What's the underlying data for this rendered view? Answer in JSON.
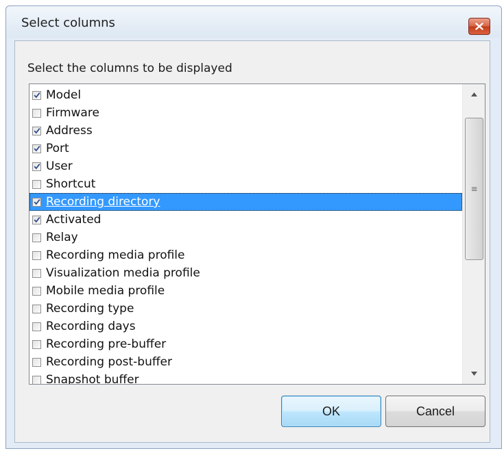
{
  "window": {
    "title": "Select columns",
    "close_icon": "close-icon"
  },
  "dialog": {
    "prompt": "Select the columns to be displayed",
    "items": [
      {
        "label": "Model",
        "checked": true,
        "selected": false
      },
      {
        "label": "Firmware",
        "checked": false,
        "selected": false
      },
      {
        "label": "Address",
        "checked": true,
        "selected": false
      },
      {
        "label": "Port",
        "checked": true,
        "selected": false
      },
      {
        "label": "User",
        "checked": true,
        "selected": false
      },
      {
        "label": "Shortcut",
        "checked": false,
        "selected": false
      },
      {
        "label": "Recording directory",
        "checked": true,
        "selected": true
      },
      {
        "label": "Activated",
        "checked": true,
        "selected": false
      },
      {
        "label": "Relay",
        "checked": false,
        "selected": false
      },
      {
        "label": "Recording media profile",
        "checked": false,
        "selected": false
      },
      {
        "label": "Visualization media profile",
        "checked": false,
        "selected": false
      },
      {
        "label": "Mobile media profile",
        "checked": false,
        "selected": false
      },
      {
        "label": "Recording type",
        "checked": false,
        "selected": false
      },
      {
        "label": "Recording days",
        "checked": false,
        "selected": false
      },
      {
        "label": "Recording pre-buffer",
        "checked": false,
        "selected": false
      },
      {
        "label": "Recording post-buffer",
        "checked": false,
        "selected": false
      },
      {
        "label": "Snapshot buffer",
        "checked": false,
        "selected": false
      }
    ],
    "scroll": {
      "thumb_start_fraction": 0.05,
      "thumb_size_fraction": 0.55
    },
    "buttons": {
      "ok_label": "OK",
      "cancel_label": "Cancel"
    }
  },
  "colors": {
    "selection": "#3399ff",
    "check_mark": "#2c4c8c",
    "close_button": "#c43c1a"
  }
}
